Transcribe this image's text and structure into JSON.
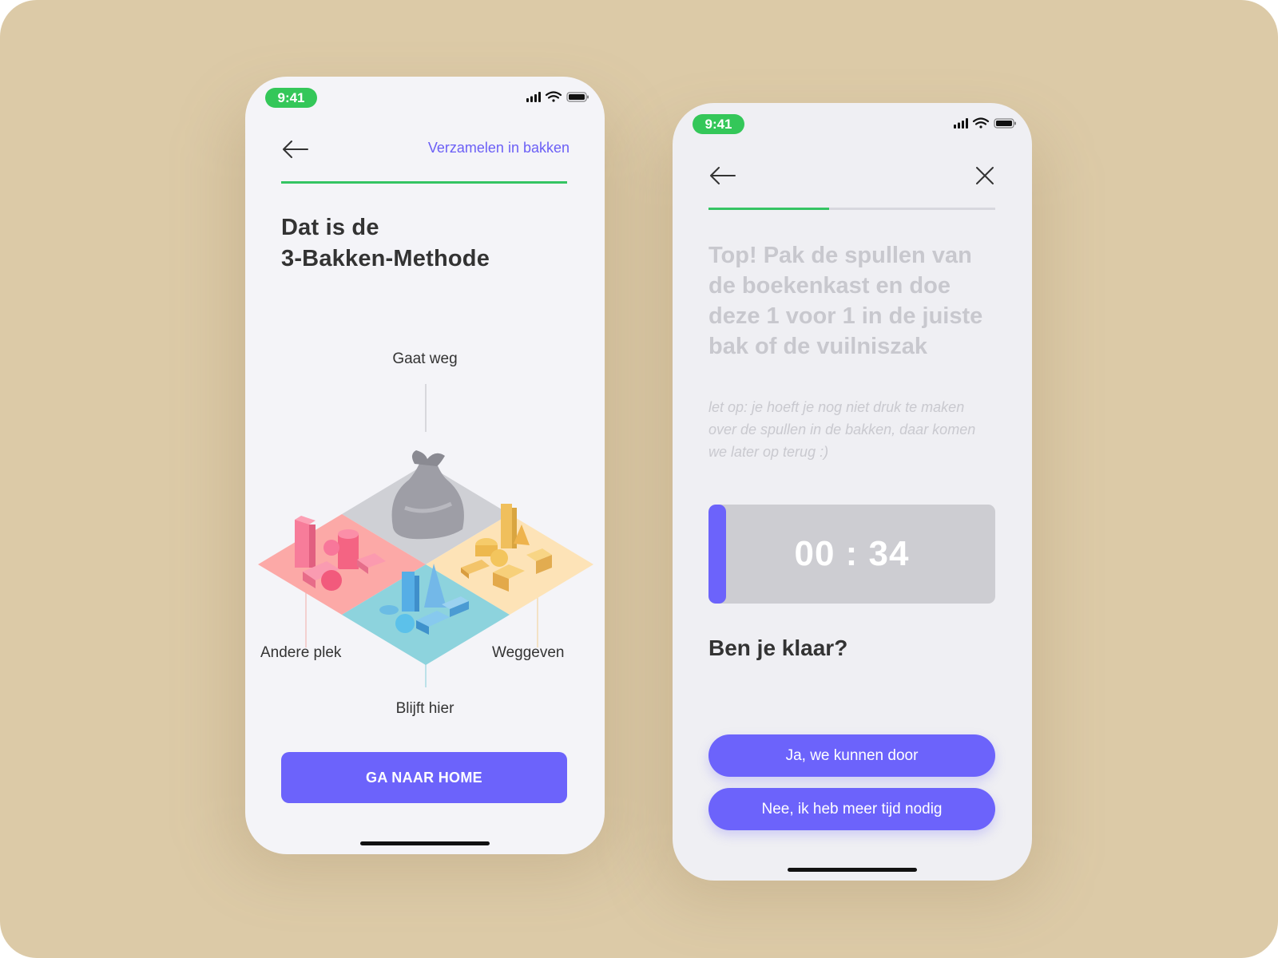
{
  "colors": {
    "background": "#dccaa7",
    "accent": "#6c63fb",
    "status_green": "#34c759",
    "progress_green": "#35c463"
  },
  "screen1": {
    "status": {
      "time": "9:41",
      "icons": [
        "signal-icon",
        "wifi-icon",
        "battery-icon"
      ]
    },
    "header": {
      "back_icon": "arrow-left-icon",
      "link": "Verzamelen in bakken",
      "progress": 1.0
    },
    "title_line1": "Dat is de",
    "title_line2": "3-Bakken-Methode",
    "illustration": {
      "labels": {
        "top": "Gaat weg",
        "left": "Andere plek",
        "right": "Weggeven",
        "bottom": "Blijft hier"
      }
    },
    "cta": "GA NAAR HOME"
  },
  "screen2": {
    "status": {
      "time": "9:41",
      "icons": [
        "signal-icon",
        "wifi-icon",
        "battery-icon"
      ]
    },
    "header": {
      "back_icon": "arrow-left-icon",
      "close_icon": "close-icon",
      "progress": 0.42
    },
    "instruction": "Top! Pak de spullen van de boekenkast en doe deze 1 voor 1 in de juiste bak of de vuilniszak",
    "note": "let op: je hoeft je nog niet druk te maken over de spullen in de bakken, daar komen we later op terug :)",
    "timer": {
      "value": "00 : 34"
    },
    "question": "Ben je klaar?",
    "buttons": {
      "yes": "Ja, we kunnen door",
      "no": "Nee, ik heb meer tijd nodig"
    }
  }
}
